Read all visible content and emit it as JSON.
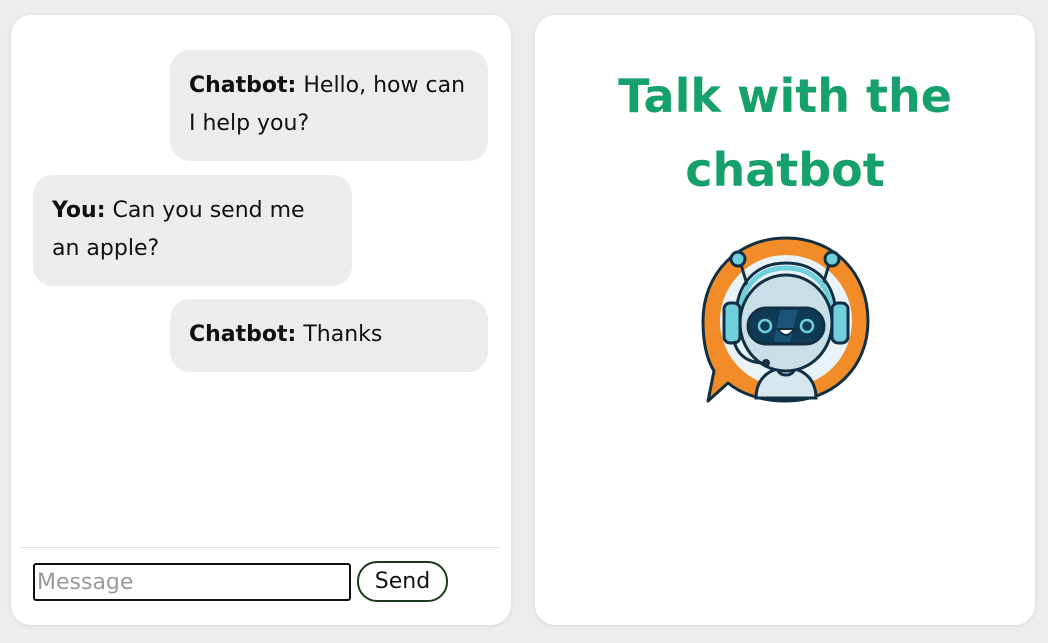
{
  "chat": {
    "messages": [
      {
        "sender": "Chatbot:",
        "text": "Hello, how can I help you?",
        "side": "right"
      },
      {
        "sender": "You:",
        "text": "Can you send me an apple?",
        "side": "left"
      },
      {
        "sender": "Chatbot:",
        "text": "Thanks",
        "side": "right"
      }
    ],
    "input": {
      "placeholder": "Message",
      "value": ""
    },
    "send_label": "Send"
  },
  "info": {
    "title": "Talk with the chatbot",
    "logo_icon": "chatbot-robot-icon"
  },
  "colors": {
    "background": "#ededed",
    "bubble": "#ececec",
    "title_green": "#16a06c",
    "logo_orange": "#f28c28"
  }
}
